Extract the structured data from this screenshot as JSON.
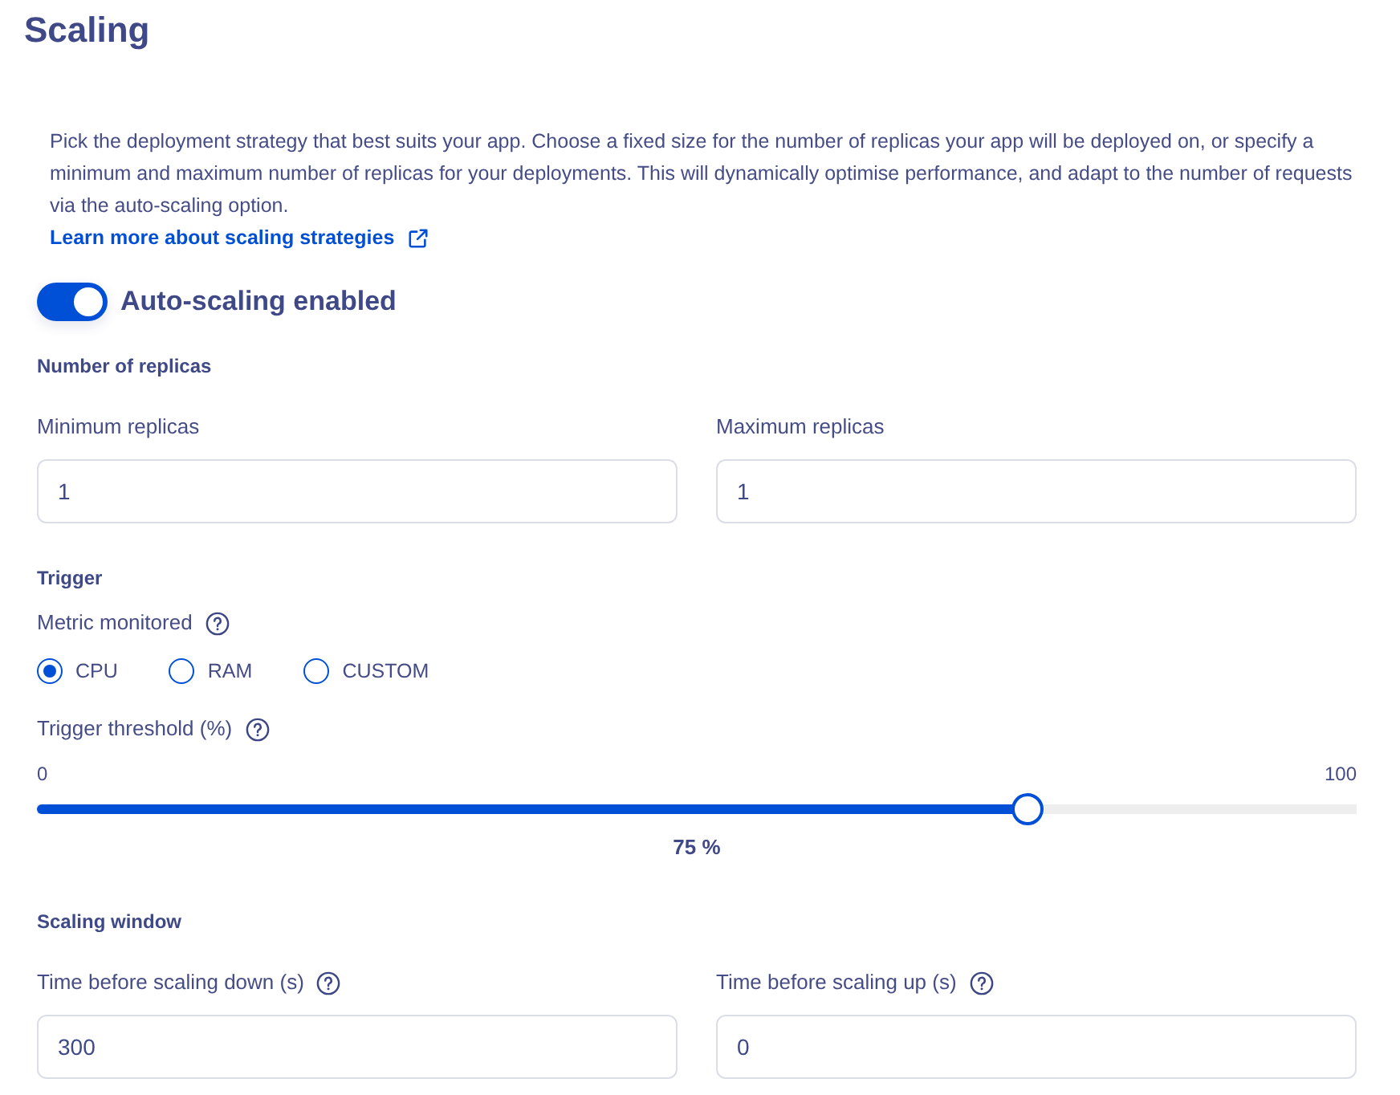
{
  "title": "Scaling",
  "description": {
    "text": "Pick the deployment strategy that best suits your app. Choose a fixed size for the number of replicas your app will be deployed on, or specify a minimum and maximum number of replicas for your deployments. This will dynamically optimise performance, and adapt to the number of requests via the auto-scaling option.",
    "link": "Learn more about scaling strategies"
  },
  "autoscaling": {
    "label": "Auto-scaling enabled",
    "on": true
  },
  "replicas": {
    "heading": "Number of replicas",
    "fields": [
      {
        "label": "Minimum replicas",
        "value": "1",
        "help": false
      },
      {
        "label": "Maximum replicas",
        "value": "1",
        "help": false
      }
    ]
  },
  "trigger": {
    "heading": "Trigger",
    "metric": {
      "label": "Metric monitored",
      "options": [
        {
          "label": "CPU",
          "selected": true
        },
        {
          "label": "RAM",
          "selected": false
        },
        {
          "label": "CUSTOM",
          "selected": false
        }
      ]
    },
    "threshold": {
      "label": "Trigger threshold (%)",
      "min_label": "0",
      "max_label": "100",
      "level": 0.75,
      "reading": "75 %"
    }
  },
  "scaling_window": {
    "heading": "Scaling window",
    "fields": [
      {
        "label": "Time before scaling down (s)",
        "value": "300",
        "help": true
      },
      {
        "label": "Time before scaling up (s)",
        "value": "0",
        "help": true
      }
    ]
  }
}
